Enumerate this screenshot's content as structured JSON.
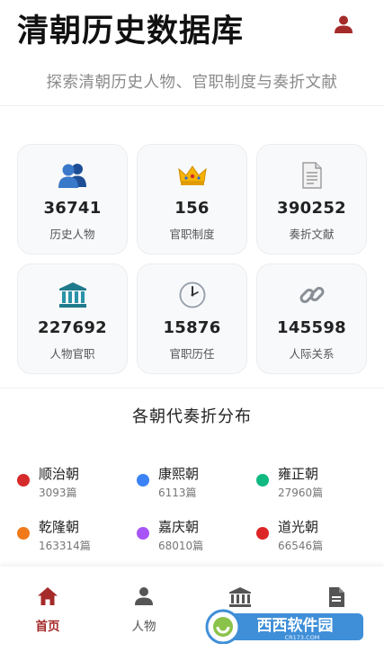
{
  "header": {
    "title": "清朝历史数据库",
    "subtitle": "探索清朝历史人物、官职制度与奏折文献",
    "user_icon": "user-icon"
  },
  "stats": [
    {
      "icon": "people-icon",
      "value": "36741",
      "label": "历史人物"
    },
    {
      "icon": "crown-icon",
      "value": "156",
      "label": "官职制度"
    },
    {
      "icon": "document-icon",
      "value": "390252",
      "label": "奏折文献"
    },
    {
      "icon": "building-icon",
      "value": "227692",
      "label": "人物官职"
    },
    {
      "icon": "clock-icon",
      "value": "15876",
      "label": "官职历任"
    },
    {
      "icon": "link-icon",
      "value": "145598",
      "label": "人际关系"
    }
  ],
  "distribution": {
    "title": "各朝代奏折分布",
    "items": [
      {
        "name": "顺治朝",
        "count": "3093篇",
        "color": "#d62b2b"
      },
      {
        "name": "康熙朝",
        "count": "6113篇",
        "color": "#3b82f6"
      },
      {
        "name": "雍正朝",
        "count": "27960篇",
        "color": "#10b981"
      },
      {
        "name": "乾隆朝",
        "count": "163314篇",
        "color": "#f07a1a"
      },
      {
        "name": "嘉庆朝",
        "count": "68010篇",
        "color": "#a855f7"
      },
      {
        "name": "道光朝",
        "count": "66546篇",
        "color": "#dc2626"
      }
    ]
  },
  "nav": {
    "items": [
      {
        "label": "首页",
        "icon": "home-icon",
        "active": true
      },
      {
        "label": "人物",
        "icon": "person-icon",
        "active": false
      },
      {
        "label": "",
        "icon": "institution-icon",
        "active": false
      },
      {
        "label": "",
        "icon": "file-icon",
        "active": false
      }
    ]
  },
  "watermark": {
    "text": "西西软件园",
    "subtext": "CR173.COM"
  },
  "colors": {
    "accent": "#a52a2a",
    "icon_blue": "#2e5fa8",
    "icon_gold": "#f5b300"
  }
}
